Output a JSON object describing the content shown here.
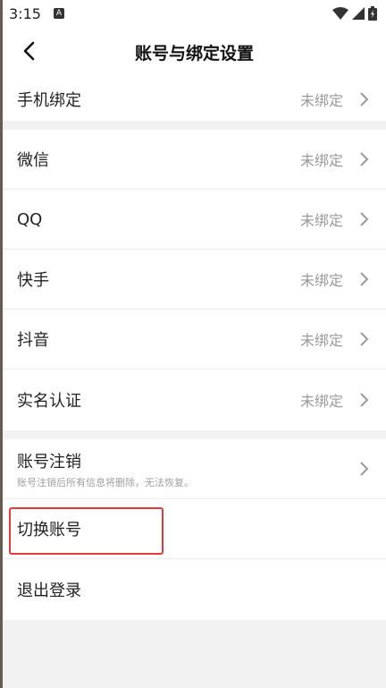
{
  "status_bar": {
    "time": "3:15",
    "notif_glyph": "A"
  },
  "header": {
    "title": "账号与绑定设置"
  },
  "bindings_top": [
    {
      "label": "手机绑定",
      "value": "未绑定"
    }
  ],
  "bindings": [
    {
      "label": "微信",
      "value": "未绑定"
    },
    {
      "label": "QQ",
      "value": "未绑定"
    },
    {
      "label": "快手",
      "value": "未绑定"
    },
    {
      "label": "抖音",
      "value": "未绑定"
    },
    {
      "label": "实名认证",
      "value": "未绑定"
    }
  ],
  "account": {
    "cancel_label": "账号注销",
    "cancel_hint": "账号注销后所有信息将删除，无法恢复。",
    "switch_label": "切换账号",
    "logout_label": "退出登录"
  },
  "colors": {
    "highlight": "#e23b3b",
    "section_gap": "#f2f2f2"
  }
}
